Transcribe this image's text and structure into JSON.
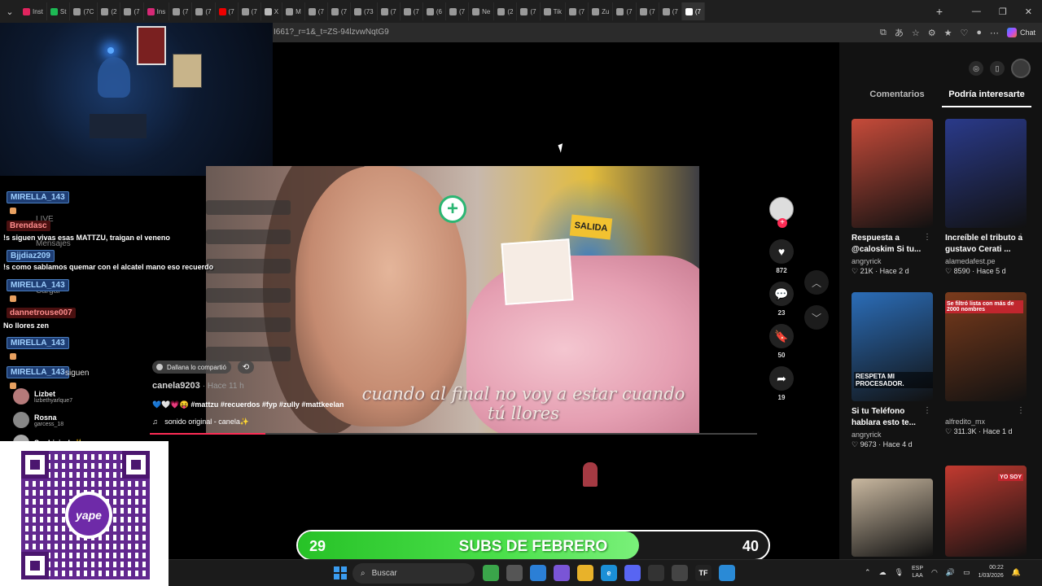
{
  "browser": {
    "tabs": [
      {
        "label": "Inst",
        "color": "#e0245e",
        "active": false
      },
      {
        "label": "St",
        "color": "#1db954"
      },
      {
        "label": "(7C",
        "color": "#999"
      },
      {
        "label": "(2",
        "color": "#999"
      },
      {
        "label": "(7",
        "color": "#999"
      },
      {
        "label": "Ins",
        "color": "#d62976"
      },
      {
        "label": "(7",
        "color": "#999"
      },
      {
        "label": "(7",
        "color": "#999"
      },
      {
        "label": "(7",
        "color": "#e00"
      },
      {
        "label": "(7",
        "color": "#999"
      },
      {
        "label": "X",
        "color": "#bbb"
      },
      {
        "label": "M",
        "color": "#999"
      },
      {
        "label": "(7",
        "color": "#999"
      },
      {
        "label": "(7",
        "color": "#999"
      },
      {
        "label": "(73",
        "color": "#999"
      },
      {
        "label": "(7",
        "color": "#999"
      },
      {
        "label": "(7",
        "color": "#999"
      },
      {
        "label": "(6",
        "color": "#999"
      },
      {
        "label": "(7",
        "color": "#999"
      },
      {
        "label": "Ne",
        "color": "#999"
      },
      {
        "label": "(2",
        "color": "#999"
      },
      {
        "label": "(7",
        "color": "#999"
      },
      {
        "label": "Tik",
        "color": "#999"
      },
      {
        "label": "(7",
        "color": "#999"
      },
      {
        "label": "Zu",
        "color": "#999"
      },
      {
        "label": "(7",
        "color": "#999"
      },
      {
        "label": "(7",
        "color": "#999"
      },
      {
        "label": "(7",
        "color": "#999"
      },
      {
        "label": "(7",
        "color": "#fff",
        "active": true
      }
    ],
    "url": "I661?_r=1&_t=ZS-94lzvwNqtG9",
    "chat_label": "Chat"
  },
  "stream_chat": {
    "messages": [
      {
        "user": "MIRELLA_143",
        "style": "blue"
      },
      {
        "user": "Brendasc",
        "style": "red",
        "text": "!s siguen vivas esas MATTZU, traigan el veneno"
      },
      {
        "user": "Bjjdiaz209",
        "style": "blue",
        "text": "!s como sablamos quemar con el alcatel mano eso recuerdo"
      },
      {
        "user": "MIRELLA_143",
        "style": "blue"
      },
      {
        "user": "dannetrouse007",
        "style": "red",
        "text": "No llores zen"
      },
      {
        "user": "MIRELLA_143",
        "style": "blue"
      },
      {
        "user": "MIRELLA_143",
        "style": "blue"
      }
    ],
    "ghosts": {
      "live": "LIVE",
      "mensajes": "Mensajes",
      "cargar": "Cargar",
      "siguen": "siguen"
    },
    "viewers": [
      {
        "name": "Lizbet",
        "handle": "lizbethyarlque7"
      },
      {
        "name": "Rosna",
        "handle": "garcess_18"
      },
      {
        "name": "Sophiejork ✨",
        "handle": ""
      }
    ]
  },
  "qr": {
    "brand": "yape"
  },
  "video": {
    "caption": "cuando al final no voy a estar cuando tú llores",
    "sign": "SALIDA",
    "shared_by": "Dallana lo compartió",
    "author": "canela9203",
    "author_time": "· Hace 11 h",
    "description": "💙🤍💗😝 #mattzu #recuerdos #fyp #zully #mattkeelan",
    "sound": "sonido original - canela✨",
    "progress_pct": 19,
    "actions": {
      "likes": "872",
      "comments": "23",
      "saves": "50",
      "shares": "19"
    }
  },
  "panel": {
    "tabs": [
      "Comentarios",
      "Podría interesarte"
    ],
    "active_tab": 1,
    "recommendations": [
      {
        "title": "Respuesta a @caloskim Si tu...",
        "author": "angryrick",
        "likes": "21K",
        "time": "Hace 2 d",
        "thumb_bg": "#c64b3a"
      },
      {
        "title": "Increíble el tributo a gustavo Cerati ...",
        "author": "alamedafest.pe",
        "likes": "8590",
        "time": "Hace 5 d",
        "thumb_bg": "#2a3a8a"
      },
      {
        "title": "Si tu Teléfono hablara esto te...",
        "author": "angryrick",
        "likes": "9673",
        "time": "Hace 4 d",
        "thumb_bg": "#2b6db8",
        "thumb_text": "RESPETA MI PROCESADOR."
      },
      {
        "title": "",
        "author": "alfredito_mx",
        "likes": "311.3K",
        "time": "Hace 1 d",
        "thumb_bg": "#7a3b1c",
        "thumb_text2": "Se filtró lista con más de 2000 nombres"
      },
      {
        "title": "",
        "author": "",
        "likes": "",
        "time": "",
        "thumb_bg": "#c9b8a0"
      },
      {
        "title": "",
        "author": "",
        "likes": "",
        "time": "",
        "thumb_bg": "#c23a30",
        "thumb_text2": "YO SOY"
      }
    ]
  },
  "subs_goal": {
    "current": "29",
    "label": "SUBS DE FEBRERO",
    "goal": "40",
    "fill_pct": 72.5
  },
  "taskbar": {
    "search": "Buscar",
    "apps": [
      {
        "name": "weather",
        "color": "#3aa54a",
        "glyph": ""
      },
      {
        "name": "taskview",
        "color": "#555",
        "glyph": ""
      },
      {
        "name": "store",
        "color": "#2b7fd6",
        "glyph": ""
      },
      {
        "name": "copilot",
        "color": "#7a55d6",
        "glyph": ""
      },
      {
        "name": "explorer",
        "color": "#e8b22a",
        "glyph": ""
      },
      {
        "name": "edge",
        "color": "#1b8fd6",
        "glyph": "e"
      },
      {
        "name": "discord",
        "color": "#5865f2",
        "glyph": ""
      },
      {
        "name": "obs",
        "color": "#333",
        "glyph": ""
      },
      {
        "name": "chrome",
        "color": "#444",
        "glyph": ""
      },
      {
        "name": "tiktok",
        "color": "#222",
        "glyph": "TF"
      },
      {
        "name": "app",
        "color": "#2a8ad6",
        "glyph": ""
      }
    ],
    "lang": "ESP",
    "lang2": "LAA",
    "time": "00:22",
    "date": "1/03/2026"
  }
}
